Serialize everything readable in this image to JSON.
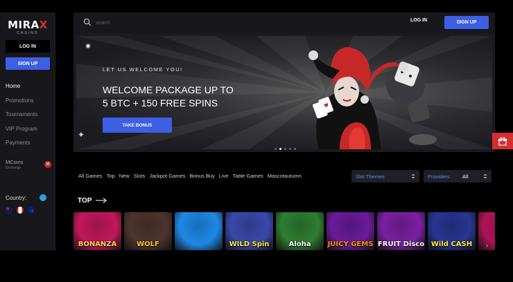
{
  "brand": {
    "logo_main_a": "MIRA",
    "logo_main_x": "X",
    "logo_sub": "CASINO"
  },
  "sidebar": {
    "login_label": "LOG IN",
    "signup_label": "SIGN UP",
    "nav": [
      "Home",
      "Promotions",
      "Tournaments",
      "VIP Program",
      "Payments"
    ],
    "mcoins_label": "MCoins",
    "mcoins_sub": "Exchange",
    "country_label": "Country:"
  },
  "header": {
    "search_placeholder": "search",
    "login_label": "LOG IN",
    "signup_label": "SIGN UP"
  },
  "banner": {
    "welcome": "LET US WELCOME YOU!",
    "headline_line1": "WELCOME PACKAGE UP TO",
    "headline_line2": "5 BTC + 150 FREE SPINS",
    "cta_label": "TAKE BONUS",
    "slides": 5,
    "active_slide": 1
  },
  "filters": {
    "categories": [
      "All Games",
      "Top",
      "New",
      "Slots",
      "Jackpot Games",
      "Bonus Buy",
      "Live",
      "Table Games",
      "Mascotautumn"
    ],
    "themes_label": "Slot Themes",
    "providers_label": "Providers",
    "providers_value": "All"
  },
  "section": {
    "title": "TOP"
  },
  "games": [
    {
      "title": "BONANZA",
      "bg": "#c2185b",
      "color": "#ffd54f"
    },
    {
      "title": "WOLF",
      "bg": "#4e342e",
      "color": "#ffca28"
    },
    {
      "title": "",
      "bg": "#1e88e5",
      "color": "#ffffff"
    },
    {
      "title": "WILD Spin",
      "bg": "#3949ab",
      "color": "#ffeb3b"
    },
    {
      "title": "Aloha",
      "bg": "#2e7d32",
      "color": "#ffffff"
    },
    {
      "title": "JUICY GEMS",
      "bg": "#6a1b9a",
      "color": "#ff9800"
    },
    {
      "title": "FRUIT Disco",
      "bg": "#7b1fa2",
      "color": "#ffffff"
    },
    {
      "title": "Wild CASH",
      "bg": "#283593",
      "color": "#ffeb3b"
    },
    {
      "title": "",
      "bg": "#ad1457",
      "color": "#ffffff"
    }
  ],
  "colors": {
    "accent": "#3d5fe3",
    "sidebar_bg": "#17171c",
    "gift": "#d32f2f"
  }
}
